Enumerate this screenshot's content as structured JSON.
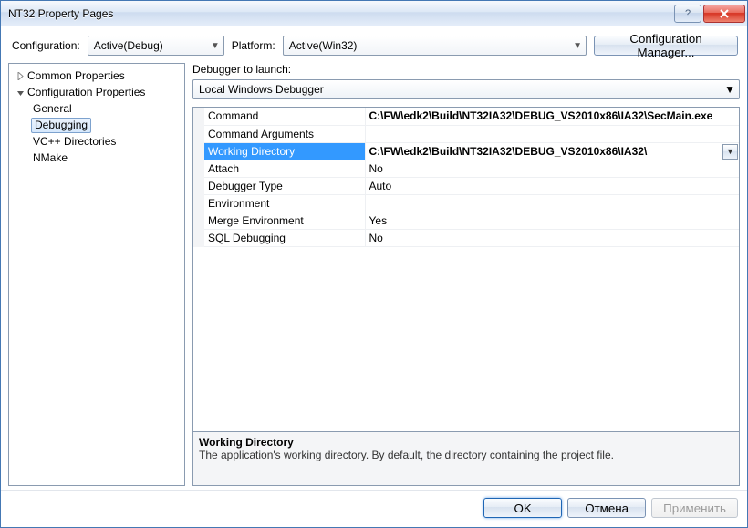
{
  "window": {
    "title": "NT32 Property Pages"
  },
  "configRow": {
    "configurationLabel": "Configuration:",
    "configurationValue": "Active(Debug)",
    "platformLabel": "Platform:",
    "platformValue": "Active(Win32)",
    "configMgrLabel": "Configuration Manager..."
  },
  "tree": {
    "items": [
      {
        "label": "Common Properties",
        "expanded": false,
        "children": []
      },
      {
        "label": "Configuration Properties",
        "expanded": true,
        "children": [
          {
            "label": "General",
            "selected": false
          },
          {
            "label": "Debugging",
            "selected": true
          },
          {
            "label": "VC++ Directories",
            "selected": false
          },
          {
            "label": "NMake",
            "selected": false
          }
        ]
      }
    ]
  },
  "launcher": {
    "label": "Debugger to launch:",
    "value": "Local Windows Debugger"
  },
  "grid": {
    "rows": [
      {
        "name": "Command",
        "value": "C:\\FW\\edk2\\Build\\NT32IA32\\DEBUG_VS2010x86\\IA32\\SecMain.exe",
        "bold": true,
        "selected": false
      },
      {
        "name": "Command Arguments",
        "value": "",
        "bold": false,
        "selected": false
      },
      {
        "name": "Working Directory",
        "value": "C:\\FW\\edk2\\Build\\NT32IA32\\DEBUG_VS2010x86\\IA32\\",
        "bold": true,
        "selected": true
      },
      {
        "name": "Attach",
        "value": "No",
        "bold": false,
        "selected": false
      },
      {
        "name": "Debugger Type",
        "value": "Auto",
        "bold": false,
        "selected": false
      },
      {
        "name": "Environment",
        "value": "",
        "bold": false,
        "selected": false
      },
      {
        "name": "Merge Environment",
        "value": "Yes",
        "bold": false,
        "selected": false
      },
      {
        "name": "SQL Debugging",
        "value": "No",
        "bold": false,
        "selected": false
      }
    ]
  },
  "description": {
    "title": "Working Directory",
    "text": "The application's working directory. By default, the directory containing the project file."
  },
  "footer": {
    "ok": "OK",
    "cancel": "Отмена",
    "apply": "Применить"
  }
}
